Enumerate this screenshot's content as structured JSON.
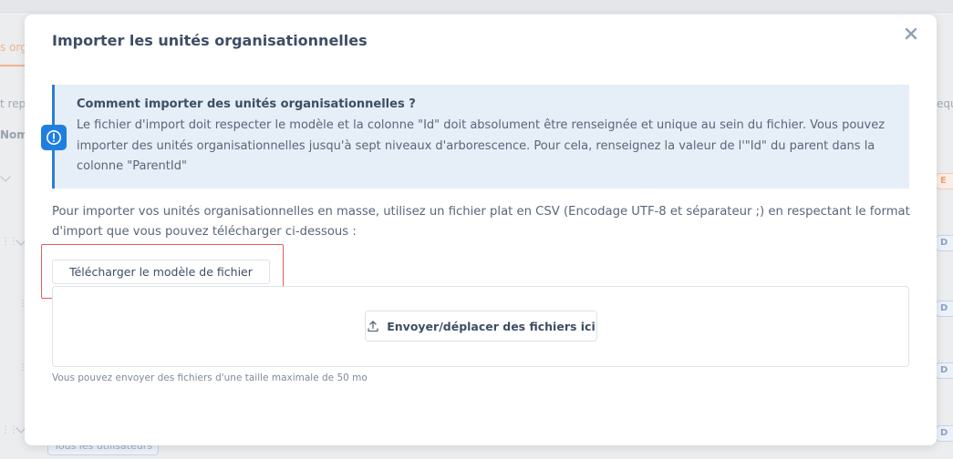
{
  "background": {
    "tab_fragment": "s org",
    "col_fragment_1": "t rep",
    "col_fragment_2": "Nom",
    "right_fragment": "equ",
    "badge_orange": "E",
    "badge_blue": "D",
    "pill_label": "Tous les utilisateurs"
  },
  "modal": {
    "title": "Importer les unités organisationnelles",
    "close_icon": "close-icon",
    "info": {
      "icon": "exclamation-circle-icon",
      "title": "Comment importer des unités organisationnelles ?",
      "body": "Le fichier d'import doit respecter le modèle et la colonne \"Id\" doit absolument être renseignée et unique au sein du fichier. Vous pouvez importer des unités organisationnelles jusqu'à sept niveaux d'arborescence. Pour cela, renseignez la valeur de l'\"Id\" du parent dans la colonne \"ParentId\""
    },
    "description": "Pour importer vos unités organisationnelles en masse, utilisez un fichier plat en CSV (Encodage UTF-8 et séparateur ;) en respectant le format d'import que vous pouvez télécharger ci-dessous :",
    "download_button": "Télécharger le modèle de fichier",
    "upload_button": "Envoyer/déplacer des fichiers ici",
    "upload_icon": "upload-icon",
    "hint": "Vous pouvez envoyer des fichiers d'une taille maximale de 50 mo"
  },
  "colors": {
    "accent": "#1f7fe0",
    "info_bg": "#e6eef7",
    "highlight": "#e05a5a",
    "title_text": "#3d4e64"
  }
}
